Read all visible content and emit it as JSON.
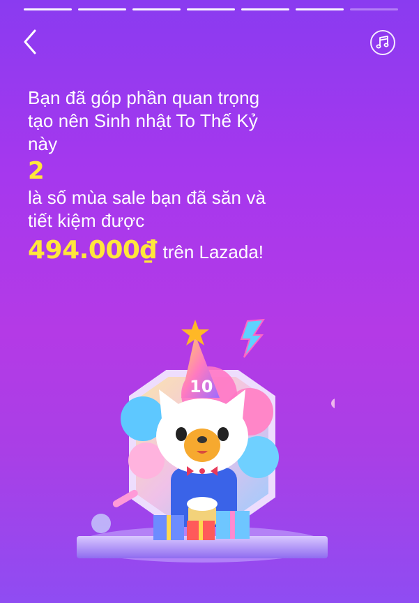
{
  "progress": {
    "total_segments": 7,
    "completed": 6
  },
  "nav": {
    "back_icon": "chevron-left-icon",
    "music_icon": "music-note-icon"
  },
  "message": {
    "line1": "Bạn đã góp phần quan trọng",
    "line2": "tạo nên Sinh nhật To Thế Kỷ",
    "line3": "này",
    "seasons_count": "2",
    "line4": "là số mùa sale bạn đã săn và",
    "line5": "tiết kiệm được",
    "saved_amount": "494.000₫",
    "amount_suffix": "trên Lazada!"
  },
  "illustration": {
    "description_icon": "birthday-mascot-illustration",
    "hat_number": "10",
    "colors": {
      "accent_yellow": "#ffe63b",
      "bg_top": "#8a3bf0",
      "bg_mid": "#b43ae6"
    }
  }
}
